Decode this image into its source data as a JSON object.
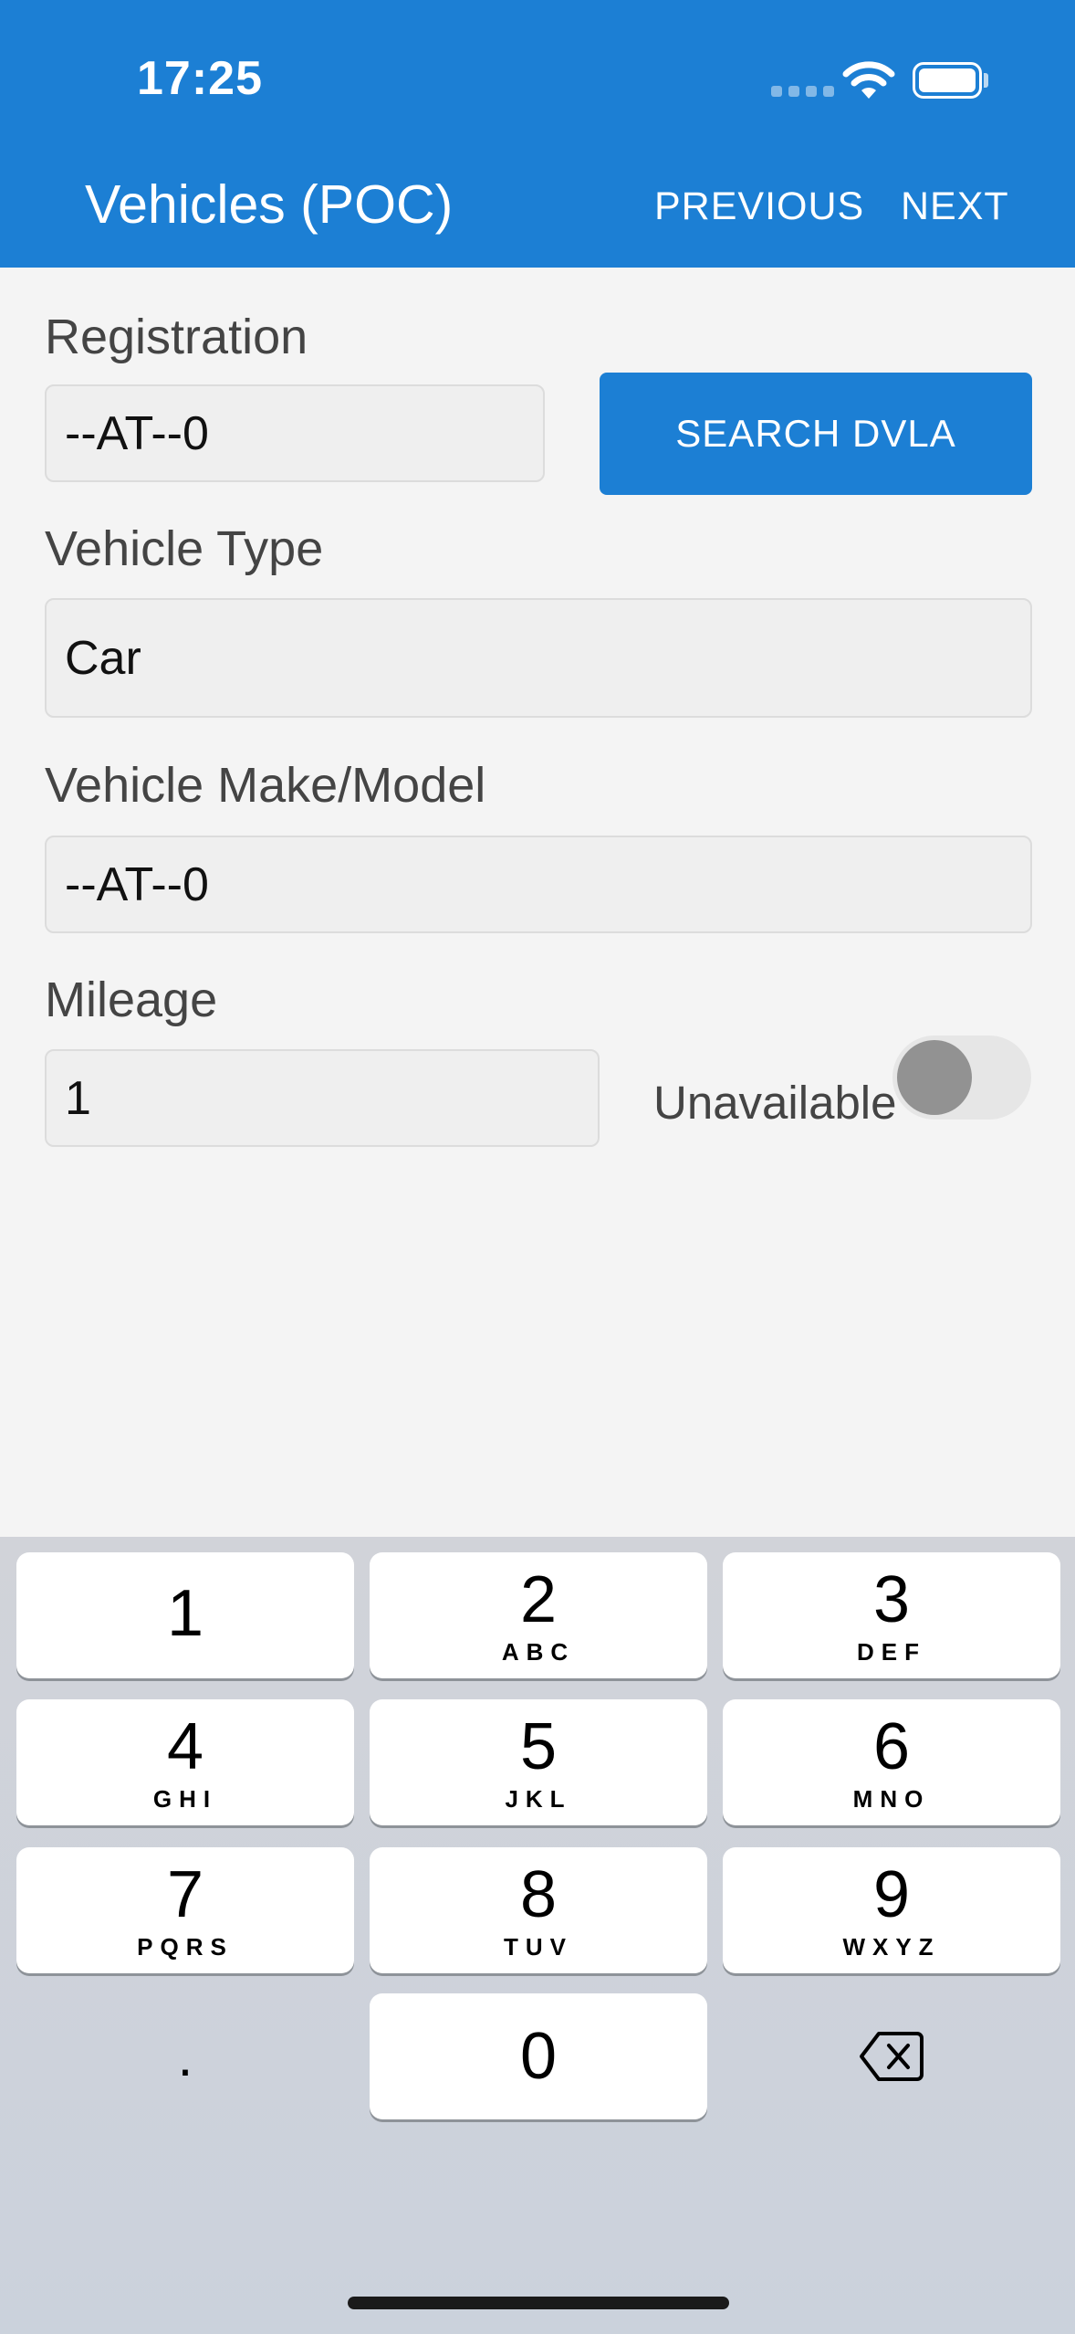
{
  "status_bar": {
    "time": "17:25"
  },
  "header": {
    "title": "Vehicles (POC)",
    "previous_label": "PREVIOUS",
    "next_label": "NEXT"
  },
  "form": {
    "registration": {
      "label": "Registration",
      "value": "--AT--0",
      "search_label": "SEARCH DVLA"
    },
    "vehicle_type": {
      "label": "Vehicle Type",
      "value": "Car"
    },
    "make_model": {
      "label": "Vehicle Make/Model",
      "value": "--AT--0"
    },
    "mileage": {
      "label": "Mileage",
      "value": "1",
      "unavailable_label": "Unavailable",
      "unavailable_on": false
    }
  },
  "keypad": {
    "keys": [
      {
        "num": "1",
        "letters": ""
      },
      {
        "num": "2",
        "letters": "ABC"
      },
      {
        "num": "3",
        "letters": "DEF"
      },
      {
        "num": "4",
        "letters": "GHI"
      },
      {
        "num": "5",
        "letters": "JKL"
      },
      {
        "num": "6",
        "letters": "MNO"
      },
      {
        "num": "7",
        "letters": "PQRS"
      },
      {
        "num": "8",
        "letters": "TUV"
      },
      {
        "num": "9",
        "letters": "WXYZ"
      },
      {
        "num": "0",
        "letters": ""
      }
    ],
    "decimal": ".",
    "delete_icon": "backspace-icon"
  }
}
